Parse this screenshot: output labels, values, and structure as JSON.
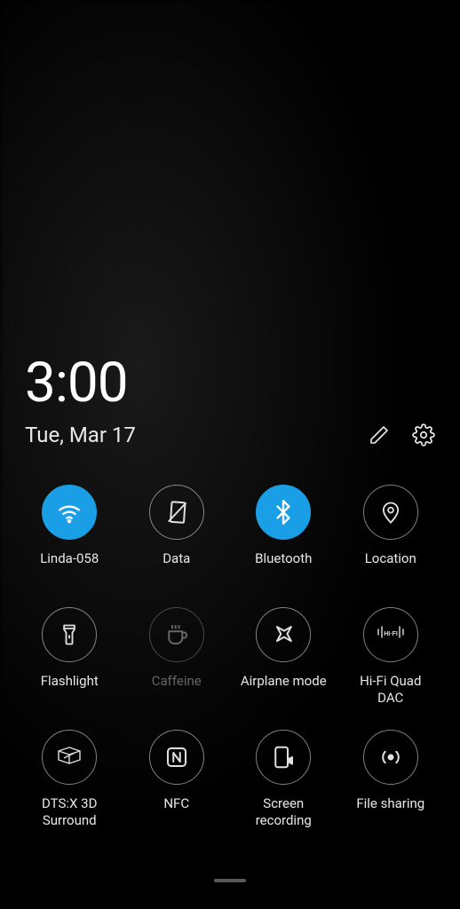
{
  "clock": {
    "time": "3:00",
    "date": "Tue, Mar 17"
  },
  "colors": {
    "accent": "#1a9ee6"
  },
  "tiles": [
    {
      "icon": "wifi",
      "label": "Linda-058",
      "active": true,
      "dim": false
    },
    {
      "icon": "data",
      "label": "Data",
      "active": false,
      "dim": false
    },
    {
      "icon": "bluetooth",
      "label": "Bluetooth",
      "active": true,
      "dim": false
    },
    {
      "icon": "location",
      "label": "Location",
      "active": false,
      "dim": false
    },
    {
      "icon": "flashlight",
      "label": "Flashlight",
      "active": false,
      "dim": false
    },
    {
      "icon": "caffeine",
      "label": "Caffeine",
      "active": false,
      "dim": true
    },
    {
      "icon": "airplane",
      "label": "Airplane mode",
      "active": false,
      "dim": false
    },
    {
      "icon": "hifi",
      "label": "Hi-Fi Quad DAC",
      "active": false,
      "dim": false
    },
    {
      "icon": "dts",
      "label": "DTS:X 3D Surround",
      "active": false,
      "dim": false
    },
    {
      "icon": "nfc",
      "label": "NFC",
      "active": false,
      "dim": false
    },
    {
      "icon": "screenrec",
      "label": "Screen recording",
      "active": false,
      "dim": false
    },
    {
      "icon": "fileshare",
      "label": "File sharing",
      "active": false,
      "dim": false
    }
  ]
}
